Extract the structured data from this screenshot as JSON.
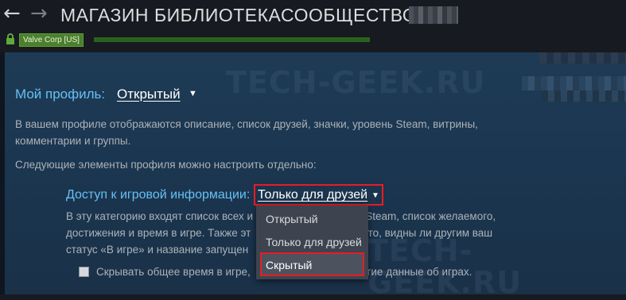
{
  "nav": {
    "back": "←",
    "forward": "→",
    "items": [
      "МАГАЗИН",
      "БИБЛИОТЕКА",
      "СООБЩЕСТВО"
    ]
  },
  "urlbar": {
    "certificate": "Valve Corp [US]"
  },
  "watermark": "TECH-GEEK.RU",
  "profile": {
    "label": "Мой профиль:",
    "value": "Открытый",
    "description": "В вашем профиле отображаются описание, список друзей, значки, уровень Steam, витрины, комментарии и группы.",
    "separate_note": "Следующие элементы профиля можно настроить отдельно:"
  },
  "game_details": {
    "label": "Доступ к игровой информации:",
    "value": "Только для друзей",
    "desc_line1_a": "В эту категорию входят список всех и",
    "desc_line1_b": "e Steam, список желаемого,",
    "desc_line2_a": "достижения и время в игре. Также эт",
    "desc_line2_b": "а то, видны ли другим ваш",
    "desc_line3_a": "статус «В игре» и название запущен",
    "checkbox_label_a": "Скрывать общее время в игре,",
    "checkbox_label_b": "угие данные об играх."
  },
  "dropdown": {
    "options": [
      "Открытый",
      "Только для друзей",
      "Скрытый"
    ],
    "highlighted": "Скрытый"
  },
  "colors": {
    "accent_blue": "#66c0f4",
    "highlight_red": "#e81c22",
    "cert_green": "#4b7f2c"
  }
}
